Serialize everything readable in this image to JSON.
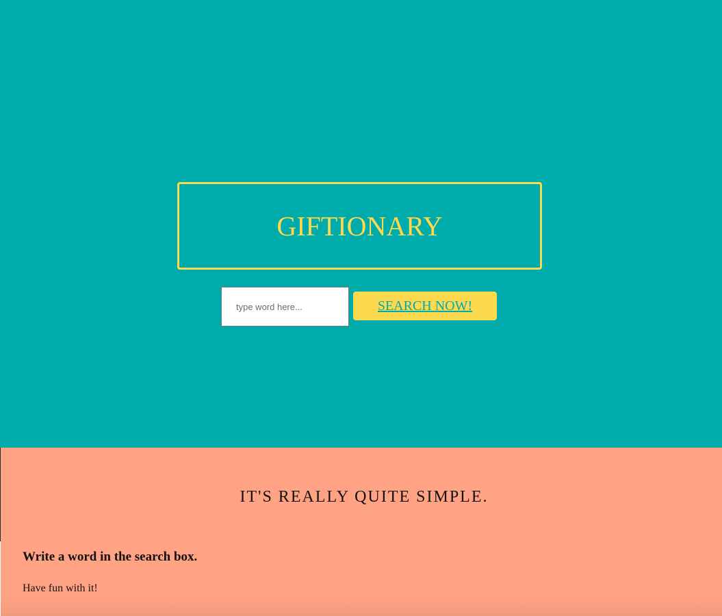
{
  "hero": {
    "title": "GIFTIONARY",
    "search": {
      "placeholder": "type word here...",
      "value": ""
    },
    "search_button_label": "SEARCH NOW!"
  },
  "info": {
    "heading": "IT'S REALLY QUITE SIMPLE.",
    "step_title": "Write a word in the search box.",
    "step_text": "Have fun with it!"
  },
  "colors": {
    "hero_background": "#00abab",
    "accent_yellow": "#fcd94f",
    "info_background": "#ffa384",
    "text_dark": "#111111"
  }
}
